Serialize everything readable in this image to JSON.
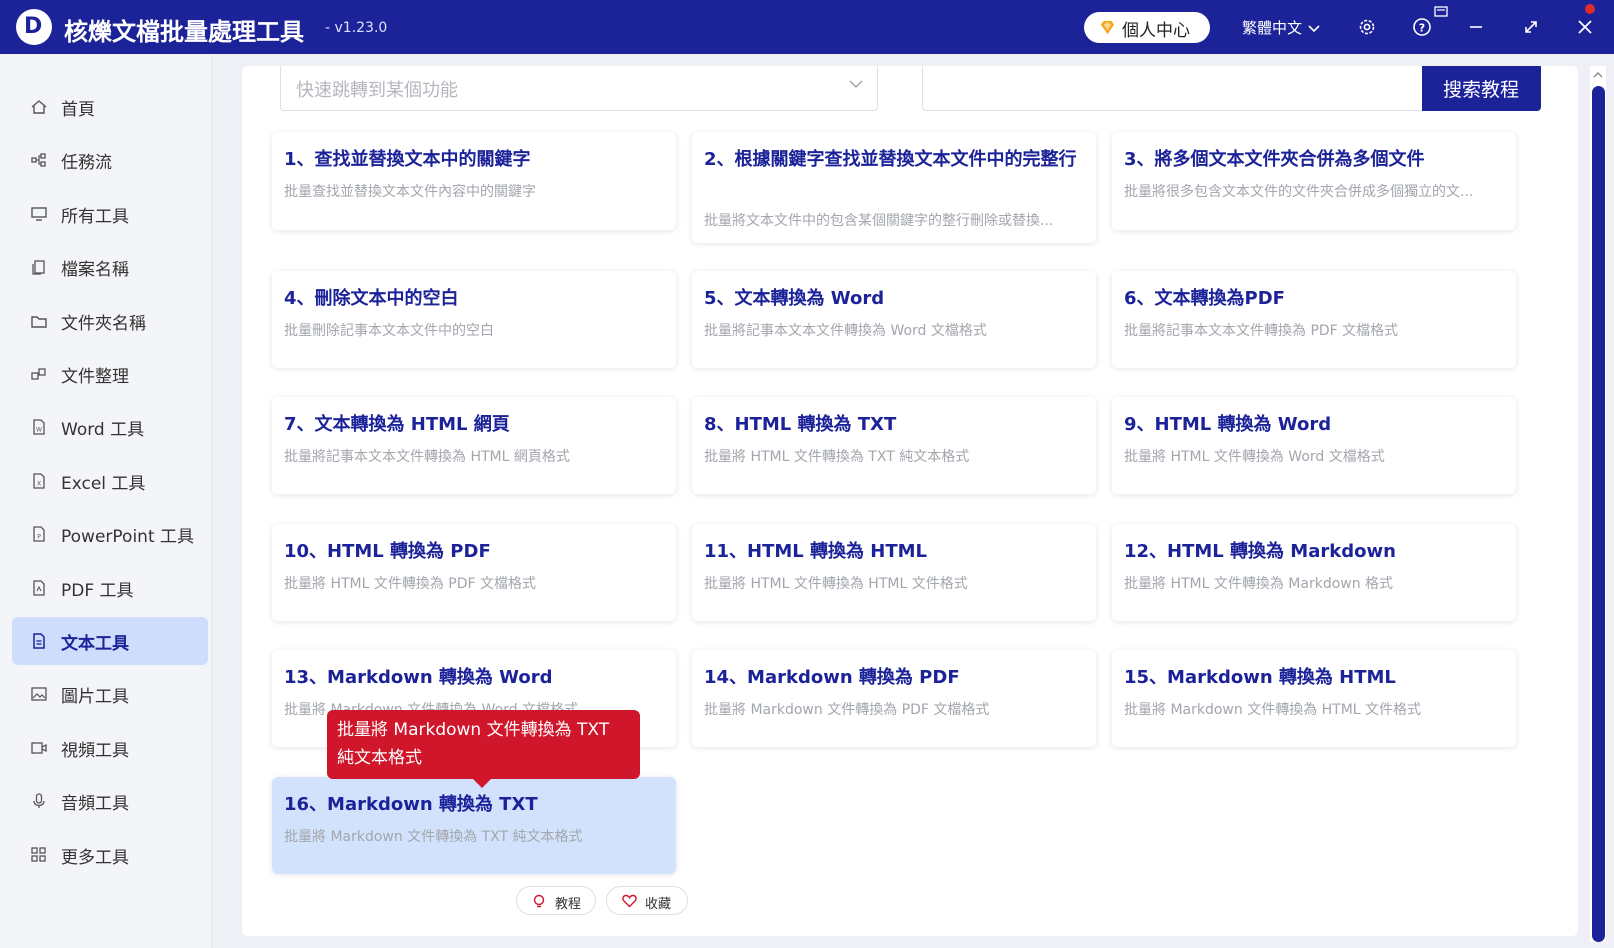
{
  "app": {
    "logo_letter": "D",
    "title": "核爍文檔批量處理工具",
    "version": "- v1.23.0",
    "profile_label": "個人中心",
    "language": "繁體中文"
  },
  "sidebar": {
    "items": [
      {
        "label": "首頁",
        "icon": "home-icon"
      },
      {
        "label": "任務流",
        "icon": "workflow-icon"
      },
      {
        "label": "所有工具",
        "icon": "monitor-icon"
      },
      {
        "label": "檔案名稱",
        "icon": "file-copy-icon"
      },
      {
        "label": "文件夾名稱",
        "icon": "folder-icon"
      },
      {
        "label": "文件整理",
        "icon": "organize-icon"
      },
      {
        "label": "Word 工具",
        "icon": "word-file-icon"
      },
      {
        "label": "Excel 工具",
        "icon": "excel-file-icon"
      },
      {
        "label": "PowerPoint 工具",
        "icon": "powerpoint-file-icon"
      },
      {
        "label": "PDF 工具",
        "icon": "pdf-file-icon"
      },
      {
        "label": "文本工具",
        "icon": "text-file-icon",
        "active": true
      },
      {
        "label": "圖片工具",
        "icon": "image-icon"
      },
      {
        "label": "視頻工具",
        "icon": "video-icon"
      },
      {
        "label": "音頻工具",
        "icon": "microphone-icon"
      },
      {
        "label": "更多工具",
        "icon": "grid-icon"
      }
    ]
  },
  "toolbar": {
    "jump_placeholder": "快速跳轉到某個功能",
    "search_value": "",
    "search_button": "搜索教程"
  },
  "cards": [
    {
      "title": "1、查找並替換文本中的關鍵字",
      "desc": "批量查找並替換文本文件內容中的關鍵字"
    },
    {
      "title": "2、根據關鍵字查找並替換文本文件中的完整行",
      "desc": "批量將文本文件中的包含某個關鍵字的整行刪除或替換..."
    },
    {
      "title": "3、將多個文本文件夾合併為多個文件",
      "desc": "批量將很多包含文本文件的文件夾合併成多個獨立的文..."
    },
    {
      "title": "4、刪除文本中的空白",
      "desc": "批量刪除記事本文本文件中的空白"
    },
    {
      "title": "5、文本轉換為 Word",
      "desc": "批量將記事本文本文件轉換為 Word 文檔格式"
    },
    {
      "title": "6、文本轉換為PDF",
      "desc": "批量將記事本文本文件轉換為 PDF 文檔格式"
    },
    {
      "title": "7、文本轉換為 HTML 網頁",
      "desc": "批量將記事本文本文件轉換為 HTML 網頁格式"
    },
    {
      "title": "8、HTML 轉換為 TXT",
      "desc": "批量將 HTML 文件轉換為 TXT 純文本格式"
    },
    {
      "title": "9、HTML 轉換為 Word",
      "desc": "批量將 HTML 文件轉換為 Word 文檔格式"
    },
    {
      "title": "10、HTML 轉換為 PDF",
      "desc": "批量將 HTML 文件轉換為 PDF 文檔格式"
    },
    {
      "title": "11、HTML 轉換為 HTML",
      "desc": "批量將 HTML 文件轉換為 HTML 文件格式"
    },
    {
      "title": "12、HTML 轉換為 Markdown",
      "desc": "批量將 HTML 文件轉換為 Markdown 格式"
    },
    {
      "title": "13、Markdown 轉換為 Word",
      "desc": "批量將 Markdown 文件轉換為 Word 文檔格式"
    },
    {
      "title": "14、Markdown 轉換為 PDF",
      "desc": "批量將 Markdown 文件轉換為 PDF 文檔格式"
    },
    {
      "title": "15、Markdown 轉換為 HTML",
      "desc": "批量將 Markdown 文件轉換為 HTML 文件格式"
    },
    {
      "title": "16、Markdown 轉換為 TXT",
      "desc": "批量將 Markdown 文件轉換為 TXT 純文本格式"
    }
  ],
  "card_actions": {
    "tutorial": "教程",
    "favorite": "收藏"
  },
  "tooltip": {
    "text": "批量將 Markdown 文件轉換為 TXT 純文本格式"
  },
  "colors": {
    "brand": "#1c2399",
    "active_bg": "#cdddfb",
    "tooltip_bg": "#d0162a"
  }
}
